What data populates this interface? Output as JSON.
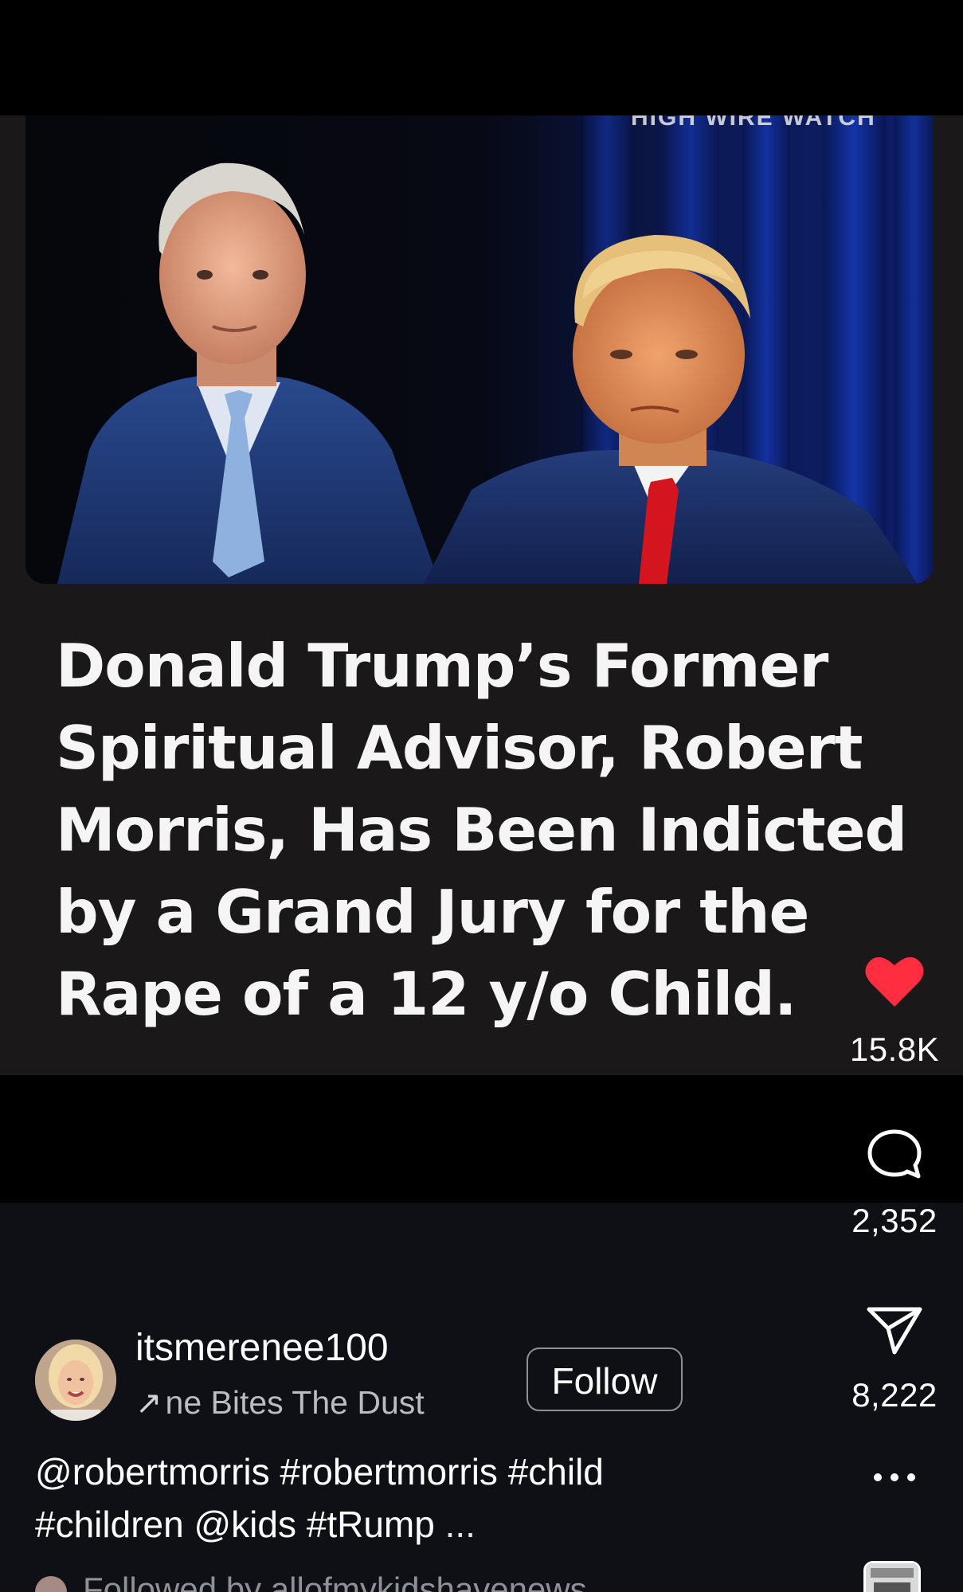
{
  "post": {
    "watermark": "HIGH WIRE WATCH",
    "headline": "Donald Trump’s Former Spiritual Advisor, Robert Morris, Has Been Indicted by a Grand Jury for the Rape of a 12 y/o Child."
  },
  "actions": {
    "like_count": "15.8K",
    "comment_count": "2,352",
    "share_count": "8,222",
    "liked_color": "#ff2d3f"
  },
  "author": {
    "username": "itsmerenee100",
    "audio_arrow": "↗",
    "audio_title": "ne Bites The Dust",
    "follow_label": "Follow"
  },
  "caption": {
    "text": "@robertmorris #robertmorris #child #children @kids #tRump",
    "more": "..."
  },
  "followed_by": {
    "text": "Followed by allofmykidshavenews"
  }
}
